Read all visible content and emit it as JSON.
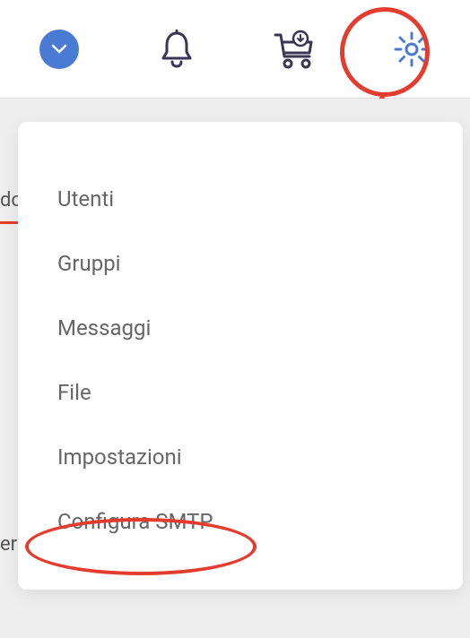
{
  "topbar": {
    "icons": {
      "chevron": "chevron-down-icon",
      "bell": "bell-icon",
      "cart": "cart-download-icon",
      "gear": "gear-icon"
    }
  },
  "partial": {
    "tab_text": "do",
    "side_text": "er"
  },
  "menu": {
    "items": [
      {
        "label": "Utenti"
      },
      {
        "label": "Gruppi"
      },
      {
        "label": "Messaggi"
      },
      {
        "label": "File"
      },
      {
        "label": "Impostazioni"
      },
      {
        "label": "Configura SMTP"
      }
    ]
  },
  "annotations": {
    "gear_circle_color": "#e43c2e",
    "smtp_circle_color": "#e43c2e"
  }
}
